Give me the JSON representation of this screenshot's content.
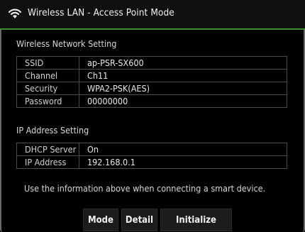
{
  "header": {
    "title": "Wireless LAN - Access Point Mode",
    "icon": "wifi-icon"
  },
  "wireless_section": {
    "title": "Wireless Network Setting",
    "rows": [
      {
        "label": "SSID",
        "value": "ap-PSR-SX600"
      },
      {
        "label": "Channel",
        "value": "Ch11"
      },
      {
        "label": "Security",
        "value": "WPA2-PSK(AES)"
      },
      {
        "label": "Password",
        "value": "00000000"
      }
    ]
  },
  "ip_section": {
    "title": "IP Address Setting",
    "rows": [
      {
        "label": "DHCP Server",
        "value": "On"
      },
      {
        "label": "IP Address",
        "value": "192.168.0.1"
      }
    ]
  },
  "note": "Use the information above when connecting a smart device.",
  "buttons": {
    "mode": "Mode",
    "detail": "Detail",
    "initialize": "Initialize"
  },
  "colors": {
    "accent_line": "#3d8f2f",
    "background": "#000000",
    "grid": "#4b4b4b"
  }
}
